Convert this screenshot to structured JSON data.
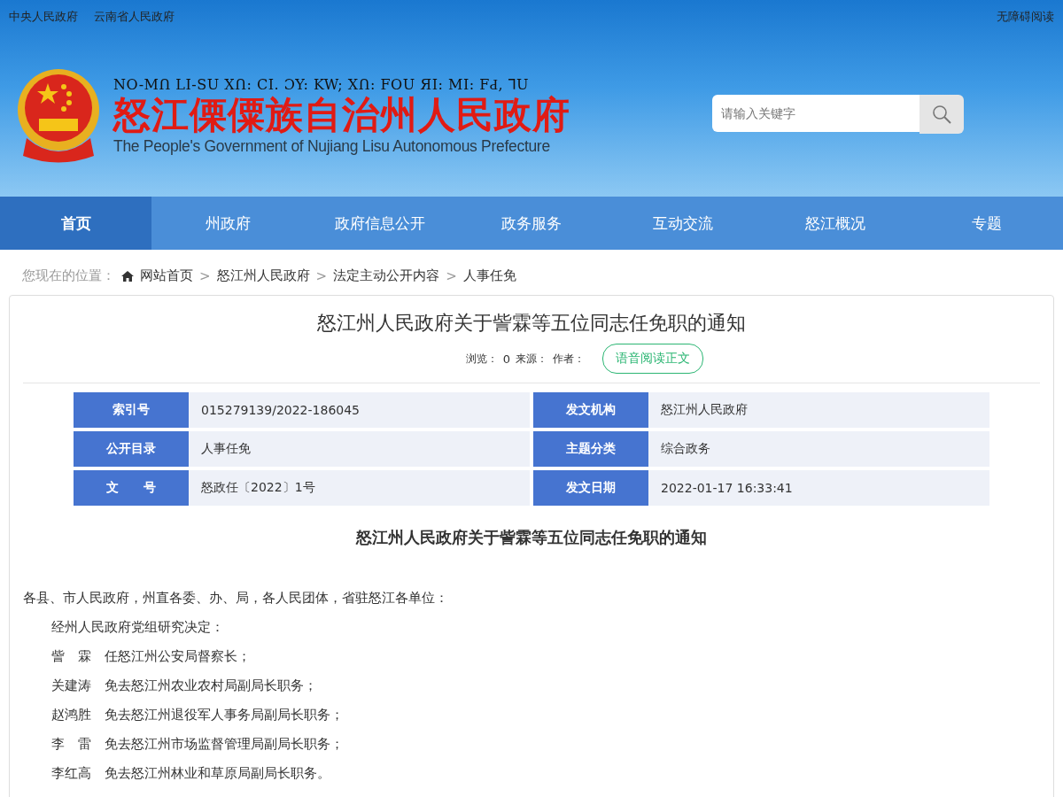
{
  "top_links": [
    "中央人民政府",
    "云南省人民政府"
  ],
  "accessibility_link": "无障碍阅读",
  "header": {
    "lisu_title": "NO-MՈ LI-SU XՈ: CI. ƆY: KW; XՈ: FOU ЯI: MI: FԀ, ⅂U",
    "title": "怒江傈僳族自治州人民政府",
    "english_title": "The People's Government of Nujiang Lisu Autonomous Prefecture"
  },
  "search": {
    "placeholder": "请输入关键字"
  },
  "nav": [
    {
      "label": "首页",
      "selected": true
    },
    {
      "label": "州政府",
      "selected": false
    },
    {
      "label": "政府信息公开",
      "selected": false
    },
    {
      "label": "政务服务",
      "selected": false
    },
    {
      "label": "互动交流",
      "selected": false
    },
    {
      "label": "怒江概况",
      "selected": false
    },
    {
      "label": "专题",
      "selected": false
    }
  ],
  "breadcrumb": {
    "prefix": "您现在的位置：",
    "items": [
      "网站首页",
      "怒江州人民政府",
      "法定主动公开内容",
      "人事任免"
    ],
    "separator": ">"
  },
  "article": {
    "title": "怒江州人民政府关于訾霖等五位同志任免职的通知",
    "meta": [
      "浏览：",
      "0",
      "来源：",
      "作者："
    ],
    "read_aloud": "语音阅读正文",
    "info": [
      {
        "label": "索引号",
        "value": "015279139/2022-186045"
      },
      {
        "label": "发文机构",
        "value": "怒江州人民政府"
      },
      {
        "label": "公开目录",
        "value": "人事任免"
      },
      {
        "label": "主题分类",
        "value": "综合政务"
      },
      {
        "label": "文　　号",
        "value": "怒政任〔2022〕1号"
      },
      {
        "label": "发文日期",
        "value": "2022-01-17 16:33:41"
      }
    ],
    "body_title": "怒江州人民政府关于訾霖等五位同志任免职的通知",
    "paragraphs": [
      {
        "text": "各县、市人民政府，州直各委、办、局，各人民团体，省驻怒江各单位：",
        "indent": false
      },
      {
        "text": "经州人民政府党组研究决定：",
        "indent": true
      },
      {
        "text": "訾　霖　任怒江州公安局督察长；",
        "indent": true
      },
      {
        "text": "关建涛　免去怒江州农业农村局副局长职务；",
        "indent": true
      },
      {
        "text": "赵鸿胜　免去怒江州退役军人事务局副局长职务；",
        "indent": true
      },
      {
        "text": "李　雷　免去怒江州市场监督管理局副局长职务；",
        "indent": true
      },
      {
        "text": "李红高　免去怒江州林业和草原局副局长职务。",
        "indent": true
      }
    ]
  }
}
